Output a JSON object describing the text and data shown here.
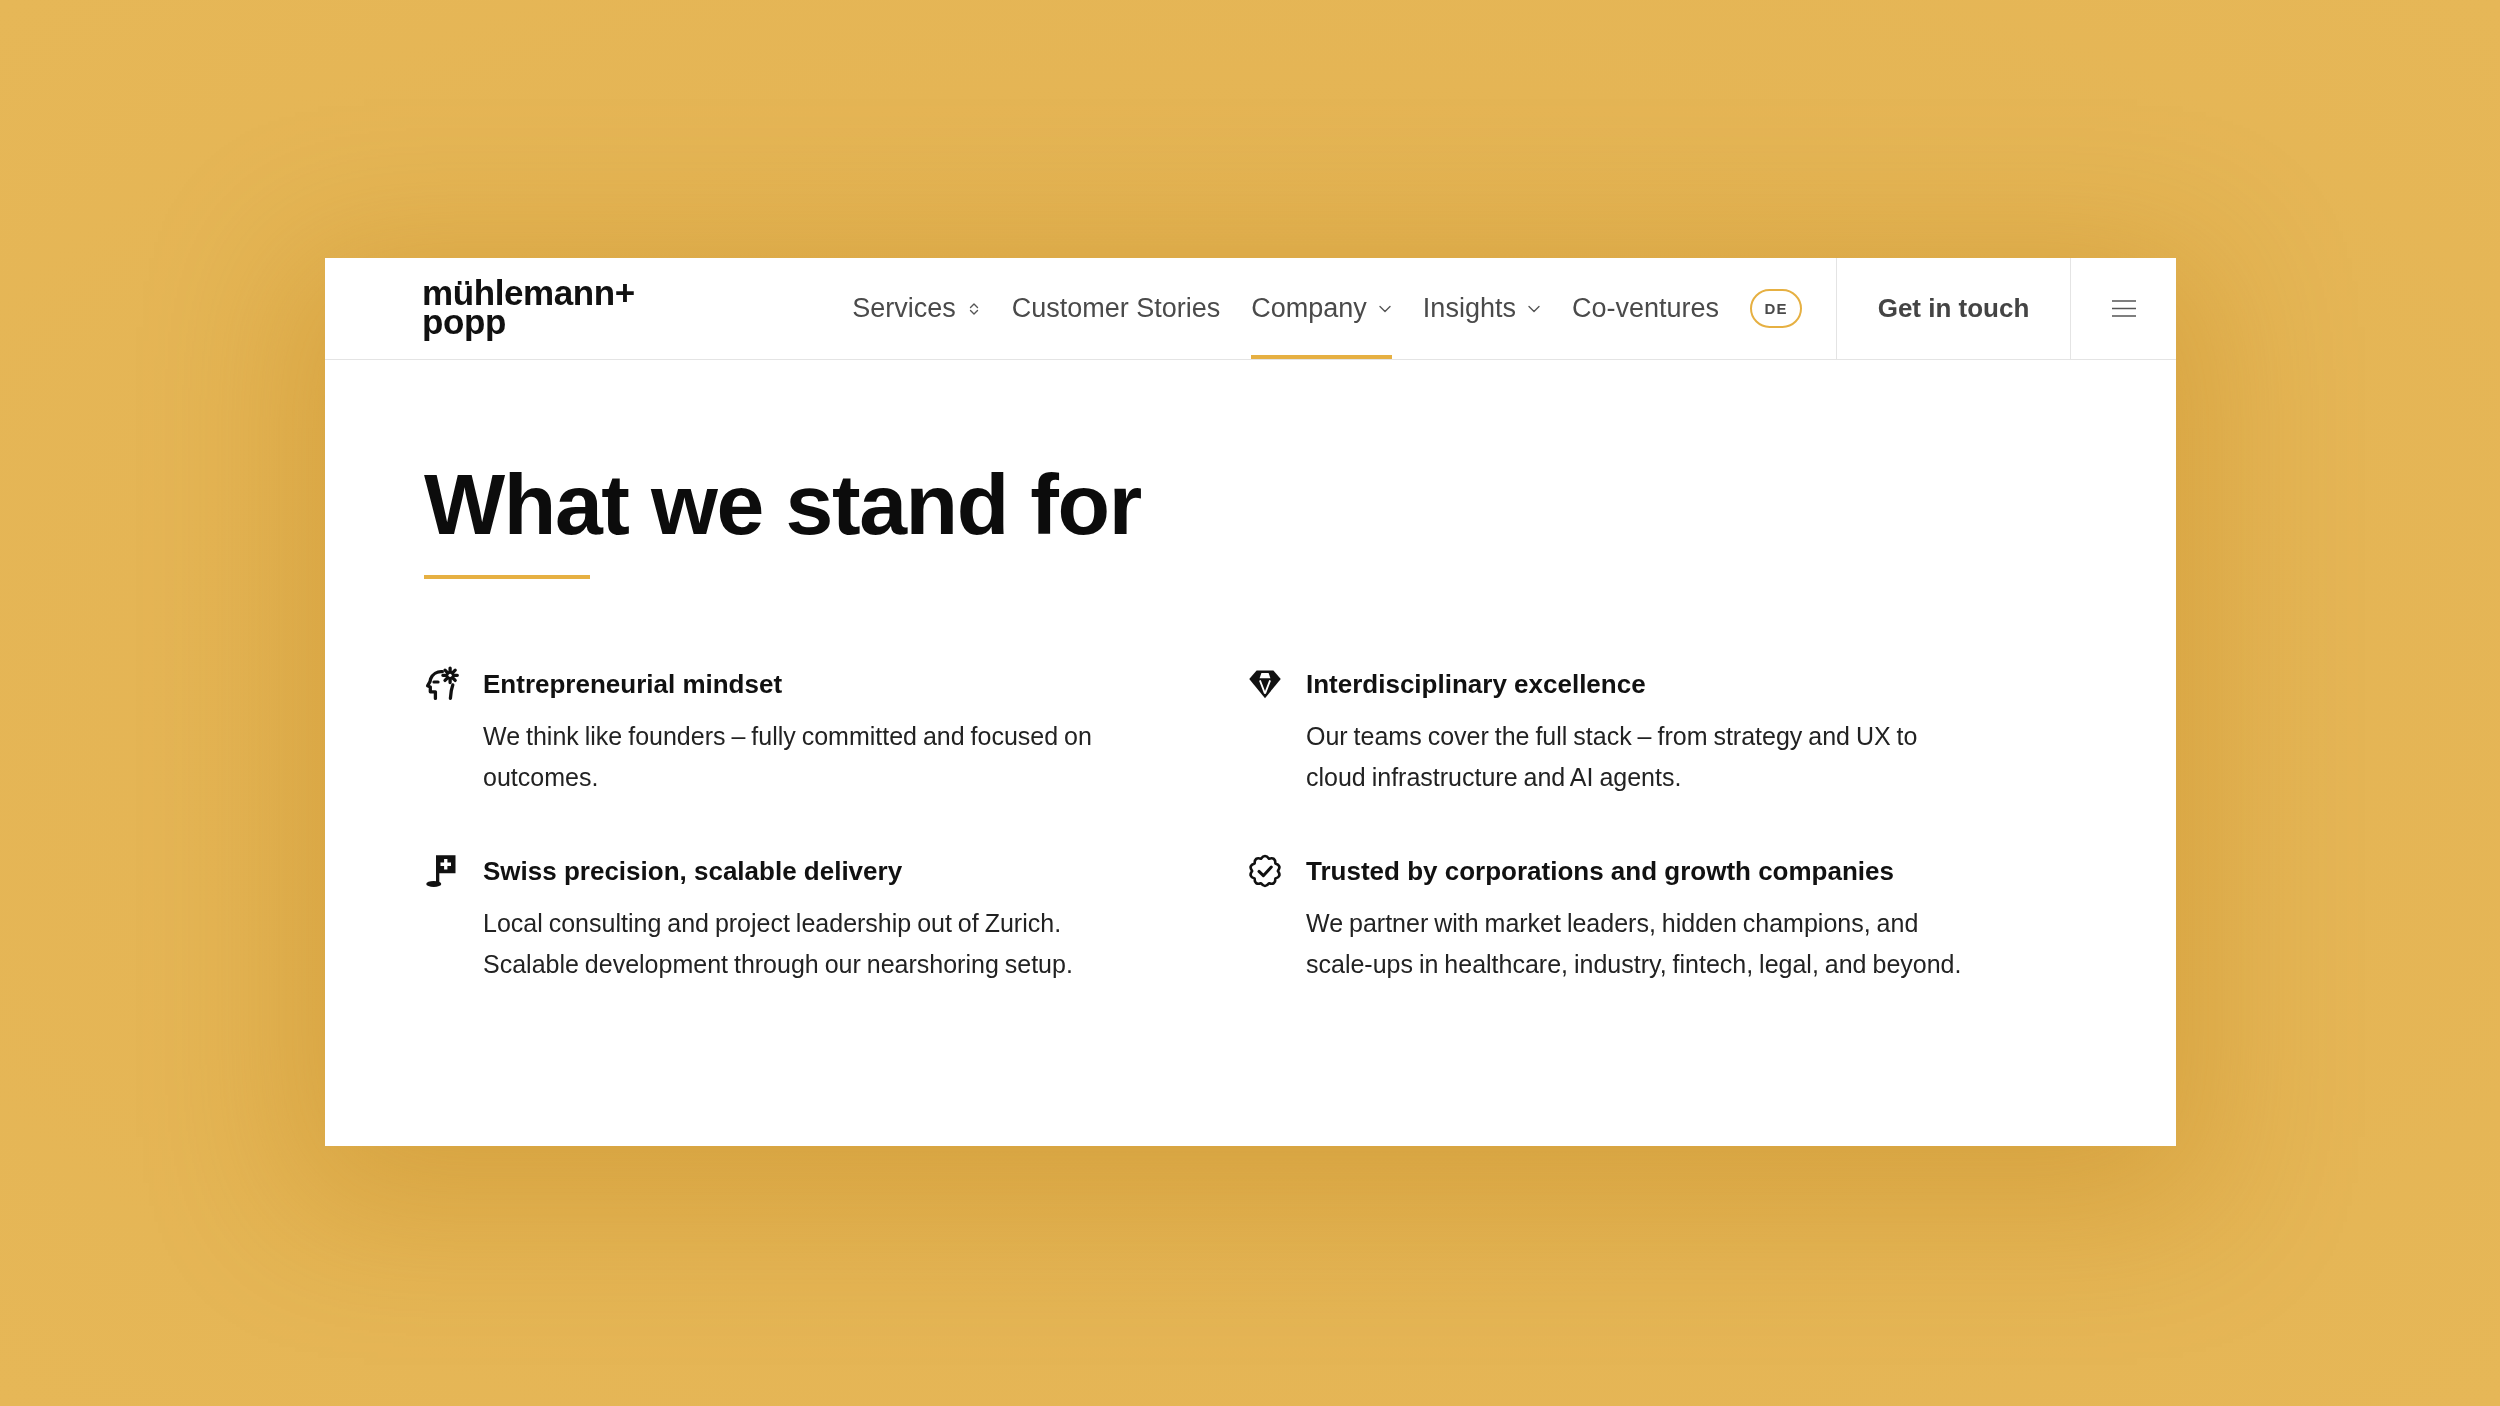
{
  "logo": {
    "lines": [
      "mühlemann+",
      "popp"
    ]
  },
  "nav": {
    "items": [
      {
        "label": "Services",
        "kind": "selector",
        "selected": false
      },
      {
        "label": "Customer Stories",
        "kind": "link",
        "selected": false
      },
      {
        "label": "Company",
        "kind": "dropdown",
        "selected": true
      },
      {
        "label": "Insights",
        "kind": "dropdown",
        "selected": false
      },
      {
        "label": "Co-ventures",
        "kind": "link",
        "selected": false
      }
    ],
    "language": "DE",
    "cta": "Get in touch"
  },
  "section": {
    "title": "What we stand for",
    "values": [
      {
        "title": "Entrepreneurial mindset",
        "text": "We think like founders – fully committed and focused on outcomes."
      },
      {
        "title": "Interdisciplinary excellence",
        "text": "Our teams cover the full stack – from strategy and UX to cloud infrastructure and AI agents."
      },
      {
        "title": "Swiss precision, scalable delivery",
        "text": "Local consulting and project leadership out of Zurich. Scalable development through our nearshoring setup."
      },
      {
        "title": "Trusted by corporations and growth companies",
        "text": "We partner with market leaders, hidden champions, and scale-ups in healthcare, industry, fintech, legal, and beyond."
      }
    ]
  }
}
